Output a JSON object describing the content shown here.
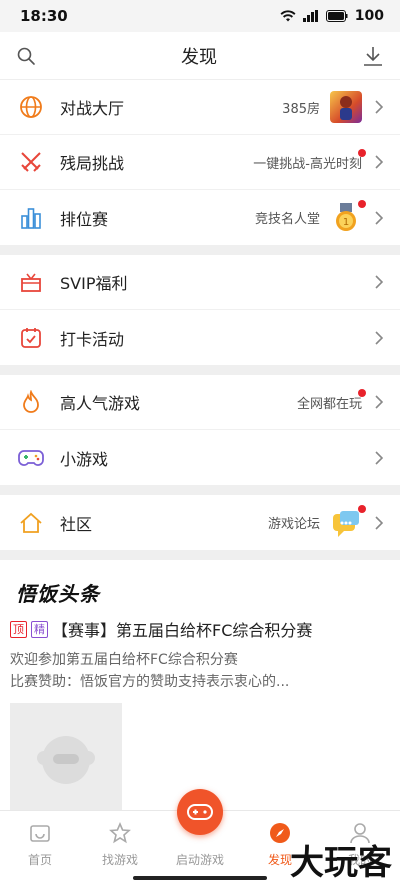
{
  "status": {
    "time": "18:30",
    "battery": "100"
  },
  "header": {
    "title": "发现"
  },
  "sections": [
    [
      {
        "label": "对战大厅",
        "sub": "385房",
        "thumb": "hero",
        "dot": false
      },
      {
        "label": "残局挑战",
        "sub": "一键挑战-高光时刻",
        "dot": true
      },
      {
        "label": "排位赛",
        "sub": "竞技名人堂",
        "thumb": "medal",
        "dot": true
      }
    ],
    [
      {
        "label": "SVIP福利"
      },
      {
        "label": "打卡活动"
      }
    ],
    [
      {
        "label": "高人气游戏",
        "sub": "全网都在玩",
        "dot": true
      },
      {
        "label": "小游戏"
      }
    ],
    [
      {
        "label": "社区",
        "sub": "游戏论坛",
        "thumb": "chat",
        "dot": true
      }
    ]
  ],
  "feed": {
    "logo": "悟饭头条",
    "tag_top": "顶",
    "tag_fine": "精",
    "title": "【赛事】第五届白给杯FC综合积分赛",
    "body_line1": "欢迎参加第五届白给杯FC综合积分赛",
    "body_line2": "比赛赞助：悟饭官方的赞助支持表示衷心的..."
  },
  "tabs": [
    {
      "label": "首页",
      "icon": "home-icon"
    },
    {
      "label": "找游戏",
      "icon": "star-icon"
    },
    {
      "label": "启动游戏",
      "icon": "gamepad-icon"
    },
    {
      "label": "发现",
      "icon": "compass-icon"
    },
    {
      "label": "我的",
      "icon": "user-icon"
    }
  ],
  "watermark": "大玩客",
  "colors": {
    "accent": "#f05a1a",
    "dot": "#e8222b"
  }
}
